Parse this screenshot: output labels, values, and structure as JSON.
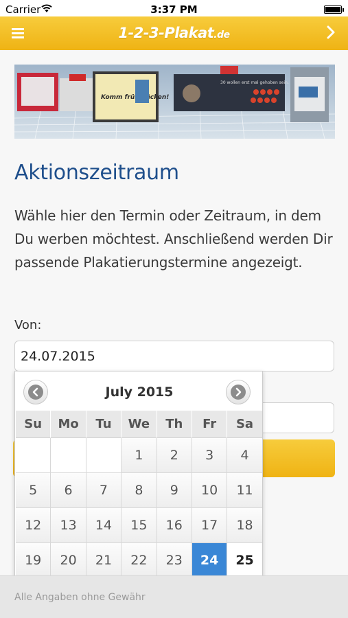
{
  "statusbar": {
    "carrier": "Carrier",
    "time": "3:37 PM"
  },
  "navbar": {
    "logo_main": "1-2-3-Plakat",
    "logo_tld": ".de"
  },
  "banner": {
    "poster_text": "Komm frühstücken!",
    "billboard_text": "30 wollen erst mal gehoben sein."
  },
  "main": {
    "title": "Aktionszeitraum",
    "intro": "Wähle hier den Termin oder Zeitraum, in dem Du werben möchtest. Anschließend werden Dir passende Plakatierungstermine angezeigt.",
    "von_label": "Von:",
    "von_value": "24.07.2015"
  },
  "datepicker": {
    "month_label": "July 2015",
    "weekdays": [
      "Su",
      "Mo",
      "Tu",
      "We",
      "Th",
      "Fr",
      "Sa"
    ],
    "weeks": [
      [
        "",
        "",
        "",
        "1",
        "2",
        "3",
        "4"
      ],
      [
        "5",
        "6",
        "7",
        "8",
        "9",
        "10",
        "11"
      ],
      [
        "12",
        "13",
        "14",
        "15",
        "16",
        "17",
        "18"
      ],
      [
        "19",
        "20",
        "21",
        "22",
        "23",
        "24",
        "25"
      ]
    ],
    "selected_day": "24",
    "today_day": "25",
    "colors": {
      "selected": "#3a87d6"
    }
  },
  "footer": {
    "text": "Alle Angaben ohne Gewähr"
  },
  "colors": {
    "brand_yellow": "#f5c12e",
    "title_blue": "#1f4f8c"
  }
}
